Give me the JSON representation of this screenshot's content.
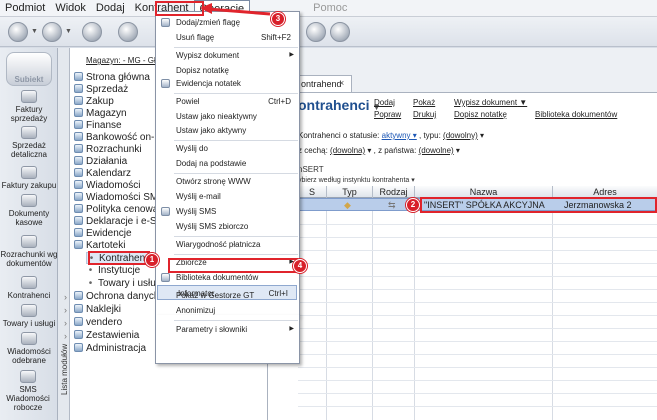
{
  "menubar": {
    "items": [
      "Podmiot",
      "Widok",
      "Dodaj",
      "Kontrahent",
      "Operacje",
      "Pomoc"
    ],
    "active": "Operacje"
  },
  "logo": {
    "text": "Subiekt"
  },
  "leftbar": {
    "items": [
      "Faktury sprzedaży",
      "Sprzedaż detaliczna",
      "Faktury zakupu",
      "Dokumenty kasowe",
      "Rozrachunki wg dokumentów",
      "Kontrahenci",
      "Towary i usługi",
      "Wiadomości odebrane",
      "SMS Wiadomości robocze"
    ],
    "strip_label": "Lista modułów"
  },
  "nav": {
    "magazyn": "Magazyn: - MG - Głó",
    "tree": [
      "Strona główna",
      "Sprzedaż",
      "Zakup",
      "Magazyn",
      "Finanse",
      "Bankowość on-line",
      "Rozrachunki",
      "Działania",
      "Kalendarz",
      "Wiadomości",
      "Wiadomości SMS",
      "Polityka cenowa",
      "Deklaracje i e-Spraw",
      "Ewidencje",
      "Kartoteki",
      "Kontrahenci",
      "Instytucje",
      "Towary i usługi",
      "Ochrona danych os",
      "Naklejki",
      "vendero",
      "Zestawienia",
      "Administracja"
    ]
  },
  "content": {
    "tab_label": "ontrahend",
    "title": "ontrahenci",
    "links": [
      "Dodaj",
      "Pokaż",
      "Wypisz dokument",
      "Popraw",
      "Drukuj",
      "Dopisz notatkę",
      "Biblioteka dokumentów"
    ],
    "filter1_label": "Kontrahenci o statusie:",
    "filter1_value": "aktywny",
    "filter1_type_label": ", typu:",
    "filter1_type_value": "(dowolny)",
    "filter2_label": "z cechą:",
    "filter2_value": "(dowolna)",
    "filter2_country_label": ", z państwa:",
    "filter2_country_value": "(dowolne)",
    "search_label": "nSERT",
    "search_hint": "ybierz według instynktu kontrahenta"
  },
  "grid": {
    "headers": [
      "S",
      "Typ",
      "Rodzaj",
      "Nazwa",
      "Adres"
    ],
    "rows": [
      {
        "name": "\"INSERT\" SPÓŁKA AKCYJNA",
        "address": "Jerzmanowska 2"
      }
    ]
  },
  "menu": {
    "items": [
      {
        "label": "Dodaj/zmień flagę",
        "shortcut": ""
      },
      {
        "label": "Usuń flagę",
        "shortcut": "Shift+F2"
      },
      {
        "label": "Wypisz dokument",
        "shortcut": "",
        "submenu": true
      },
      {
        "label": "Dopisz notatkę",
        "shortcut": ""
      },
      {
        "label": "Ewidencja notatek",
        "shortcut": ""
      },
      {
        "label": "Powiel",
        "shortcut": "Ctrl+D"
      },
      {
        "label": "Ustaw jako nieaktywny",
        "shortcut": ""
      },
      {
        "label": "Ustaw jako aktywny",
        "shortcut": ""
      },
      {
        "label": "Wyślij do",
        "shortcut": ""
      },
      {
        "label": "Dodaj na podstawie",
        "shortcut": ""
      },
      {
        "label": "Otwórz stronę WWW",
        "shortcut": ""
      },
      {
        "label": "Wyślij e-mail",
        "shortcut": ""
      },
      {
        "label": "Wyślij SMS",
        "shortcut": ""
      },
      {
        "label": "Wyślij SMS zbiorczo",
        "shortcut": ""
      },
      {
        "label": "Wiarygodność płatnicza",
        "shortcut": ""
      },
      {
        "label": "Zbiorcze",
        "shortcut": "",
        "submenu": true
      },
      {
        "label": "Biblioteka dokumentów",
        "shortcut": ""
      },
      {
        "label": "Informator",
        "shortcut": "Ctrl+I"
      },
      {
        "label": "Pokaż w Gestorze GT",
        "shortcut": ""
      },
      {
        "label": "Anonimizuj",
        "shortcut": ""
      },
      {
        "label": "Parametry i słowniki",
        "shortcut": "",
        "submenu": true
      }
    ]
  },
  "callouts": [
    "1",
    "2",
    "3",
    "4"
  ],
  "colors": {
    "accent": "#1f4f8f",
    "callout": "#d8202a",
    "selection": "#b9cdea"
  }
}
